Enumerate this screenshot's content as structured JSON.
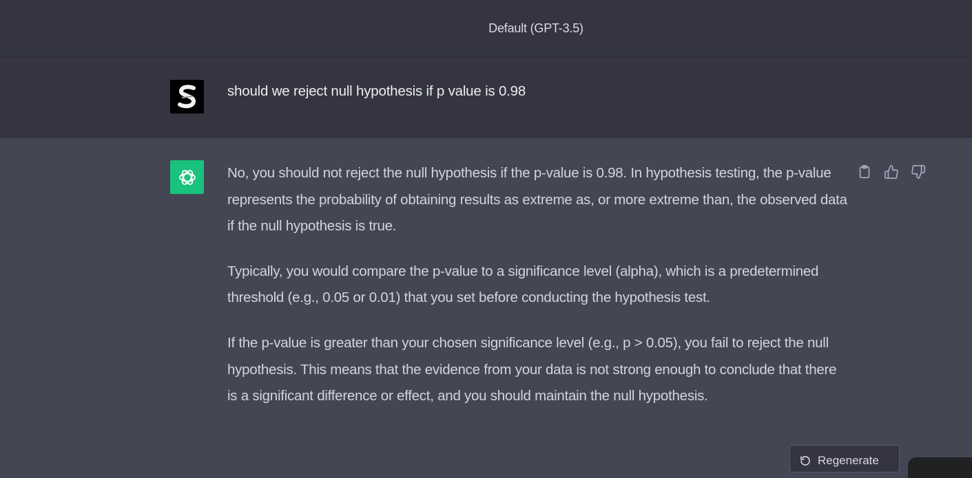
{
  "header": {
    "model_title": "Default (GPT-3.5)"
  },
  "conversation": {
    "user_message": "should we reject null hypothesis if p value is 0.98",
    "assistant_paragraphs": [
      "No, you should not reject the null hypothesis if the p-value is 0.98. In hypothesis testing, the p-value represents the probability of obtaining results as extreme as, or more extreme than, the observed data if the null hypothesis is true.",
      "Typically, you would compare the p-value to a significance level (alpha), which is a predetermined threshold (e.g., 0.05 or 0.01) that you set before conducting the hypothesis test.",
      "If the p-value is greater than your chosen significance level (e.g., p > 0.05), you fail to reject the null hypothesis. This means that the evidence from your data is not strong enough to conclude that there is a significant difference or effect, and you should maintain the null hypothesis."
    ]
  },
  "actions": {
    "icons": [
      "clipboard-icon",
      "thumbs-up-icon",
      "thumbs-down-icon"
    ]
  },
  "footer": {
    "regenerate_label": "Regenerate"
  },
  "colors": {
    "background": "#444654",
    "header_background": "#343541",
    "gpt_accent": "#19c37d",
    "text": "#d1d5db"
  }
}
